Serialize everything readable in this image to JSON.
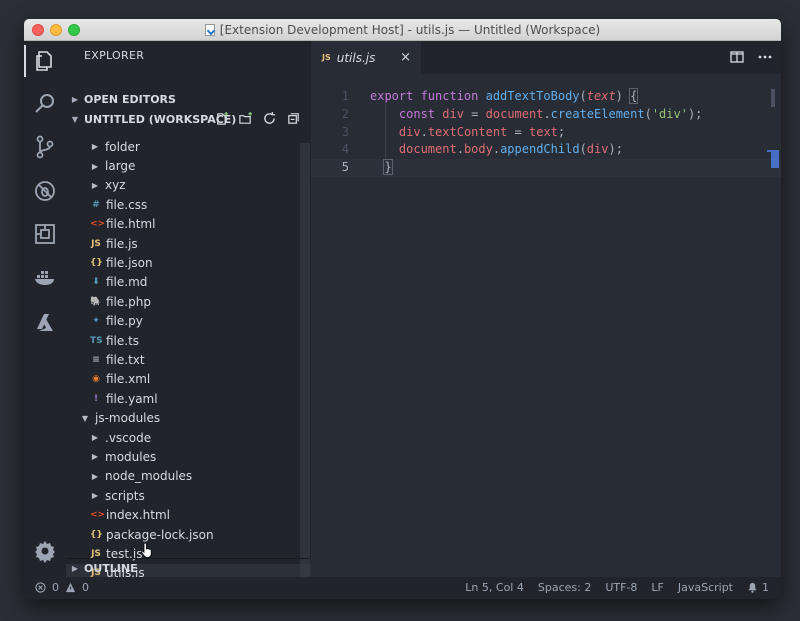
{
  "window": {
    "title": "[Extension Development Host] - utils.js — Untitled (Workspace)"
  },
  "activity_bar": [
    {
      "name": "explorer-icon",
      "active": true
    },
    {
      "name": "search-icon",
      "active": false
    },
    {
      "name": "source-control-icon",
      "active": false
    },
    {
      "name": "debug-icon",
      "active": false
    },
    {
      "name": "extensions-icon",
      "active": false
    },
    {
      "name": "docker-icon",
      "active": false
    },
    {
      "name": "azure-icon",
      "active": false
    }
  ],
  "sidebar": {
    "title": "EXPLORER",
    "open_editors": "OPEN EDITORS",
    "workspace": "UNTITLED (WORKSPACE)",
    "outline": "OUTLINE",
    "tree": [
      {
        "label": "folder",
        "kind": "folder",
        "depth": 1,
        "icon": "chevron-right-icon"
      },
      {
        "label": "large",
        "kind": "folder",
        "depth": 1,
        "icon": "chevron-right-icon"
      },
      {
        "label": "xyz",
        "kind": "folder",
        "depth": 1,
        "icon": "chevron-right-icon"
      },
      {
        "label": "file.css",
        "kind": "file",
        "depth": 1,
        "glyph": "#",
        "color": "#519aba",
        "icon": "css-file-icon"
      },
      {
        "label": "file.html",
        "kind": "file",
        "depth": 1,
        "glyph": "<>",
        "color": "#e44d26",
        "icon": "html-file-icon"
      },
      {
        "label": "file.js",
        "kind": "file",
        "depth": 1,
        "glyph": "JS",
        "color": "#e5c07b",
        "icon": "js-file-icon"
      },
      {
        "label": "file.json",
        "kind": "file",
        "depth": 1,
        "glyph": "{}",
        "color": "#e5c07b",
        "icon": "json-file-icon"
      },
      {
        "label": "file.md",
        "kind": "file",
        "depth": 1,
        "glyph": "⬇",
        "color": "#519aba",
        "icon": "markdown-file-icon"
      },
      {
        "label": "file.php",
        "kind": "file",
        "depth": 1,
        "glyph": "🐘",
        "color": "#a074c4",
        "icon": "php-file-icon"
      },
      {
        "label": "file.py",
        "kind": "file",
        "depth": 1,
        "glyph": "✦",
        "color": "#519aba",
        "icon": "python-file-icon"
      },
      {
        "label": "file.ts",
        "kind": "file",
        "depth": 1,
        "glyph": "TS",
        "color": "#519aba",
        "icon": "typescript-file-icon"
      },
      {
        "label": "file.txt",
        "kind": "file",
        "depth": 1,
        "glyph": "≡",
        "color": "#abb2bf",
        "icon": "text-file-icon"
      },
      {
        "label": "file.xml",
        "kind": "file",
        "depth": 1,
        "glyph": "◉",
        "color": "#e37933",
        "icon": "xml-file-icon"
      },
      {
        "label": "file.yaml",
        "kind": "file",
        "depth": 1,
        "glyph": "!",
        "color": "#a074c4",
        "icon": "yaml-file-icon"
      },
      {
        "label": "js-modules",
        "kind": "folder-open",
        "depth": 0,
        "icon": "chevron-down-icon"
      },
      {
        "label": ".vscode",
        "kind": "folder",
        "depth": 1,
        "icon": "chevron-right-icon"
      },
      {
        "label": "modules",
        "kind": "folder",
        "depth": 1,
        "icon": "chevron-right-icon"
      },
      {
        "label": "node_modules",
        "kind": "folder",
        "depth": 1,
        "icon": "chevron-right-icon"
      },
      {
        "label": "scripts",
        "kind": "folder",
        "depth": 1,
        "icon": "chevron-right-icon"
      },
      {
        "label": "index.html",
        "kind": "file",
        "depth": 1,
        "glyph": "<>",
        "color": "#e44d26",
        "icon": "html-file-icon"
      },
      {
        "label": "package-lock.json",
        "kind": "file",
        "depth": 1,
        "glyph": "{}",
        "color": "#e5c07b",
        "icon": "json-file-icon"
      },
      {
        "label": "test.js",
        "kind": "file",
        "depth": 1,
        "glyph": "JS",
        "color": "#e5c07b",
        "icon": "js-file-icon"
      },
      {
        "label": "utils.js",
        "kind": "file",
        "depth": 1,
        "glyph": "JS",
        "color": "#e5c07b",
        "icon": "js-file-icon",
        "selected": true
      }
    ]
  },
  "editor": {
    "tab": {
      "badge": "JS",
      "name": "utils.js",
      "close": "×"
    },
    "line_numbers": [
      "1",
      "2",
      "3",
      "4",
      "5"
    ],
    "code": [
      [
        {
          "t": "export ",
          "c": "k"
        },
        {
          "t": "function ",
          "c": "k"
        },
        {
          "t": "addTextToBody",
          "c": "fn"
        },
        {
          "t": "(",
          "c": "d"
        },
        {
          "t": "text",
          "c": "p"
        },
        {
          "t": ") ",
          "c": "d"
        },
        {
          "t": "{",
          "c": "d"
        }
      ],
      [
        {
          "t": "    ",
          "c": "d"
        },
        {
          "t": "const ",
          "c": "k"
        },
        {
          "t": "div",
          "c": "v"
        },
        {
          "t": " = ",
          "c": "d"
        },
        {
          "t": "document",
          "c": "v"
        },
        {
          "t": ".",
          "c": "d"
        },
        {
          "t": "createElement",
          "c": "fn"
        },
        {
          "t": "(",
          "c": "d"
        },
        {
          "t": "'div'",
          "c": "s"
        },
        {
          "t": ");",
          "c": "d"
        }
      ],
      [
        {
          "t": "    ",
          "c": "d"
        },
        {
          "t": "div",
          "c": "v"
        },
        {
          "t": ".",
          "c": "d"
        },
        {
          "t": "textContent",
          "c": "v"
        },
        {
          "t": " = ",
          "c": "d"
        },
        {
          "t": "text",
          "c": "v"
        },
        {
          "t": ";",
          "c": "d"
        }
      ],
      [
        {
          "t": "    ",
          "c": "d"
        },
        {
          "t": "document",
          "c": "v"
        },
        {
          "t": ".",
          "c": "d"
        },
        {
          "t": "body",
          "c": "v"
        },
        {
          "t": ".",
          "c": "d"
        },
        {
          "t": "appendChild",
          "c": "fn"
        },
        {
          "t": "(",
          "c": "d"
        },
        {
          "t": "div",
          "c": "v"
        },
        {
          "t": ");",
          "c": "d"
        }
      ],
      [
        {
          "t": "  ",
          "c": "d"
        },
        {
          "t": "}",
          "c": "d"
        }
      ]
    ],
    "current_line": 5
  },
  "status": {
    "errors": "0",
    "warnings": "0",
    "position": "Ln 5, Col 4",
    "spaces": "Spaces: 2",
    "encoding": "UTF-8",
    "eol": "LF",
    "language": "JavaScript",
    "notifications": "1"
  },
  "colors": {
    "background": "#282c34",
    "sidebar": "#21252b",
    "keyword": "#c678dd",
    "function": "#61afef",
    "variable": "#e06c75",
    "string": "#98c379"
  }
}
